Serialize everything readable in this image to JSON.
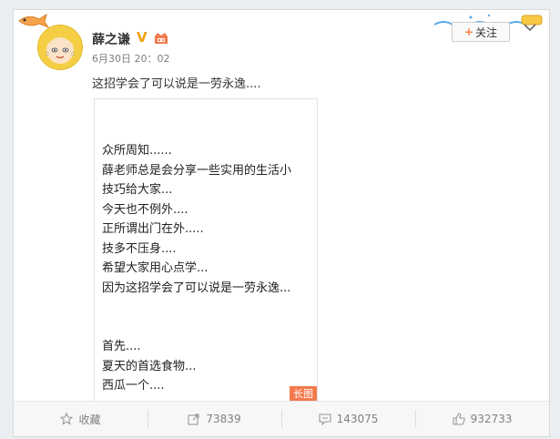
{
  "post": {
    "author": "薛之谦",
    "time": "6月30日 20：02",
    "text": "这招学会了可以说是一劳永逸....",
    "follow_label": "关注",
    "follow_plus": "+",
    "verified_mark": "V",
    "long_image": {
      "lines": [
        "众所周知......",
        "薛老师总是会分享一些实用的生活小",
        "技巧给大家...",
        "今天也不例外....",
        "正所谓出门在外.....",
        "技多不压身....",
        "希望大家用心点学...",
        "因为这招学会了可以说是一劳永逸...",
        "",
        "",
        "首先....",
        "夏天的首选食物...",
        "西瓜一个...."
      ],
      "badge": "长图"
    }
  },
  "actions": {
    "favorite_label": "收藏",
    "repost_count": "73839",
    "comment_count": "143075",
    "like_count": "932733"
  },
  "colors": {
    "accent": "#ff8140",
    "verified": "#f0a20e",
    "long_badge": "#f37a4c"
  }
}
